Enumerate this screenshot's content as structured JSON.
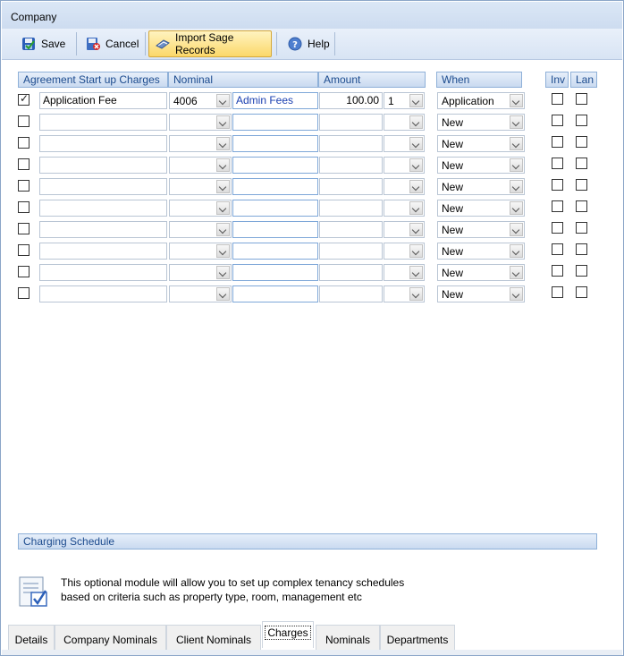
{
  "window": {
    "title": "Company"
  },
  "toolbar": {
    "save_label": "Save",
    "cancel_label": "Cancel",
    "import_label": "Import Sage Records",
    "help_label": "Help"
  },
  "table": {
    "headers": {
      "charges": "Agreement Start up Charges",
      "nominal": "Nominal",
      "amount": "Amount",
      "when": "When",
      "inv": "Inv",
      "lan": "Lan"
    },
    "rows": [
      {
        "checked": true,
        "charge": "Application Fee",
        "nominal": "4006",
        "nominal_name": "Admin Fees",
        "amount": "100.00",
        "qty": "1",
        "when": "Application"
      },
      {
        "checked": false,
        "charge": "",
        "nominal": "",
        "nominal_name": "",
        "amount": "",
        "qty": "",
        "when": "New"
      },
      {
        "checked": false,
        "charge": "",
        "nominal": "",
        "nominal_name": "",
        "amount": "",
        "qty": "",
        "when": "New"
      },
      {
        "checked": false,
        "charge": "",
        "nominal": "",
        "nominal_name": "",
        "amount": "",
        "qty": "",
        "when": "New"
      },
      {
        "checked": false,
        "charge": "",
        "nominal": "",
        "nominal_name": "",
        "amount": "",
        "qty": "",
        "when": "New"
      },
      {
        "checked": false,
        "charge": "",
        "nominal": "",
        "nominal_name": "",
        "amount": "",
        "qty": "",
        "when": "New"
      },
      {
        "checked": false,
        "charge": "",
        "nominal": "",
        "nominal_name": "",
        "amount": "",
        "qty": "",
        "when": "New"
      },
      {
        "checked": false,
        "charge": "",
        "nominal": "",
        "nominal_name": "",
        "amount": "",
        "qty": "",
        "when": "New"
      },
      {
        "checked": false,
        "charge": "",
        "nominal": "",
        "nominal_name": "",
        "amount": "",
        "qty": "",
        "when": "New"
      },
      {
        "checked": false,
        "charge": "",
        "nominal": "",
        "nominal_name": "",
        "amount": "",
        "qty": "",
        "when": "New"
      }
    ]
  },
  "schedule": {
    "header": "Charging Schedule",
    "info_line1": "This optional module will allow you to set up complex tenancy schedules",
    "info_line2": "based on criteria such as property type, room, management etc"
  },
  "tabs": [
    "Details",
    "Company Nominals",
    "Client Nominals",
    "Charges",
    "Nominals",
    "Departments"
  ],
  "active_tab": "Charges",
  "colors": {
    "header_text": "#1c4b8e",
    "link_text": "#1a3fb0",
    "active_button": "#fbd86a"
  }
}
